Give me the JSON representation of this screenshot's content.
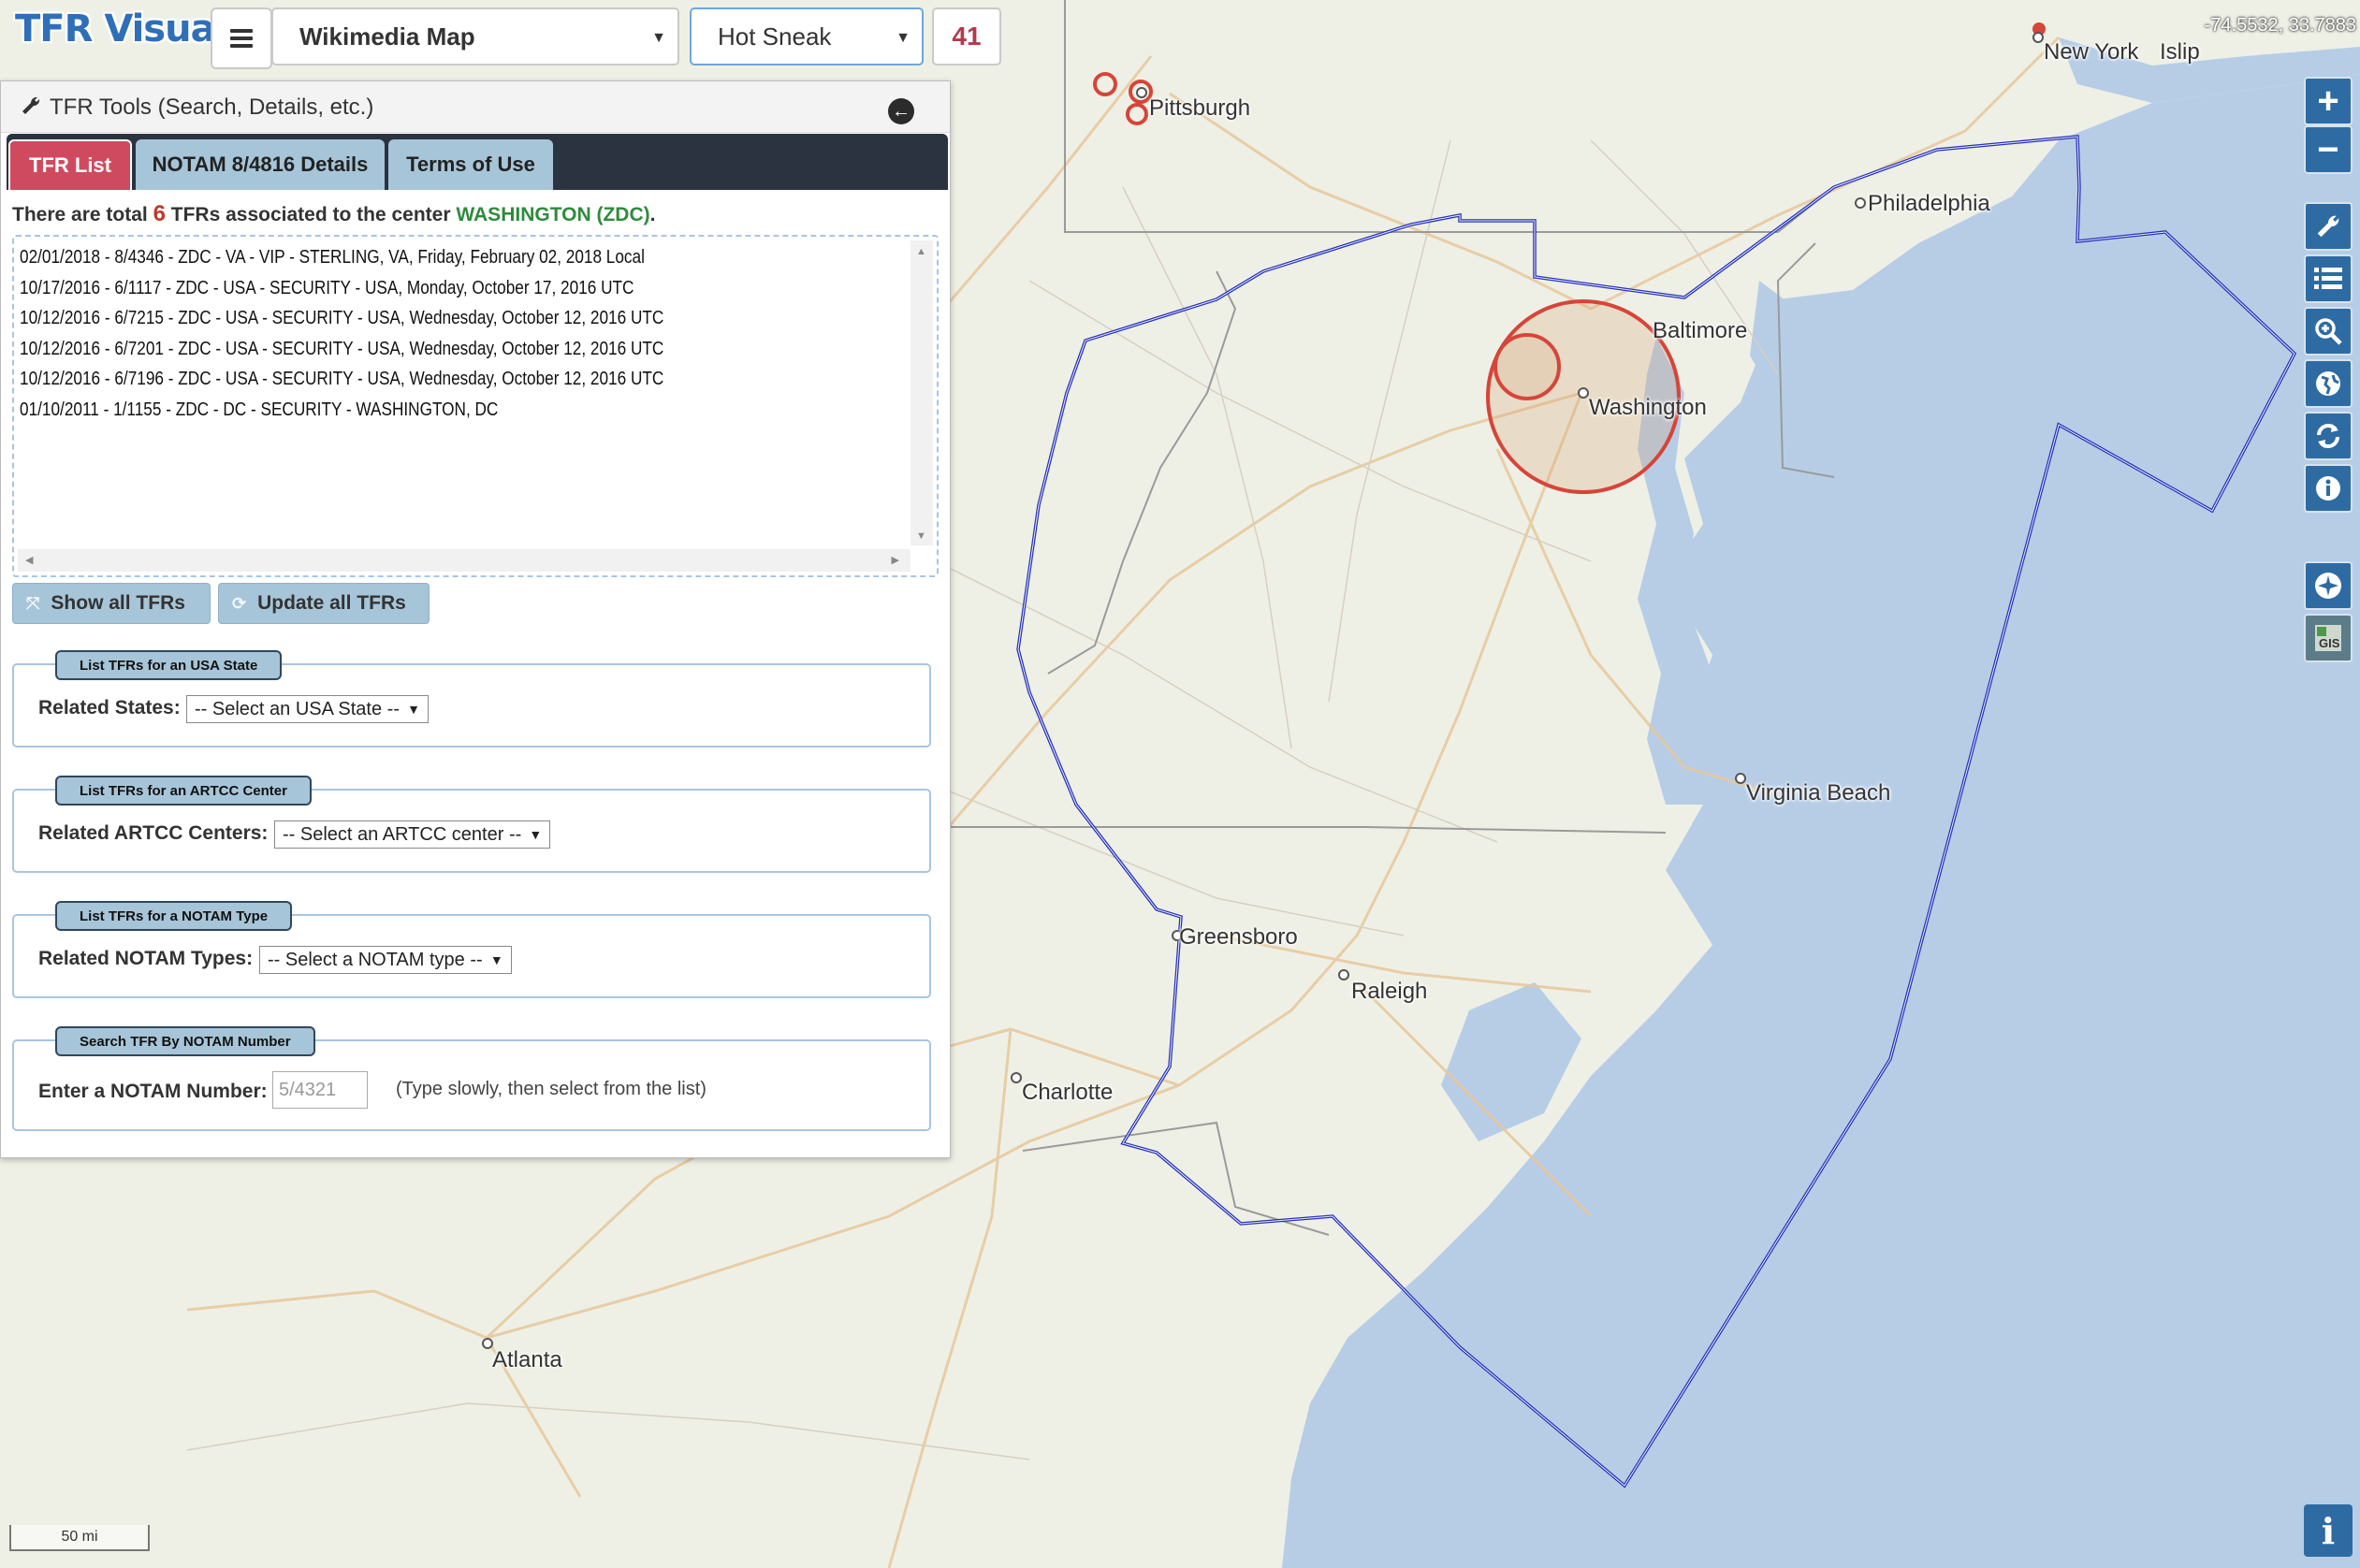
{
  "app": {
    "title": "TFR Visualizer"
  },
  "toolbar": {
    "map_layer": "Wikimedia Map",
    "map_style": "Hot Sneak",
    "tfr_count": "41",
    "coordinates": "-74.5532, 33.7883"
  },
  "panel": {
    "title": "TFR Tools (Search, Details, etc.)",
    "tabs": [
      "TFR List",
      "NOTAM 8/4816 Details",
      "Terms of Use"
    ],
    "summary": {
      "prefix": "There are total",
      "count": "6",
      "middle": "TFRs associated to the center",
      "center": "WASHINGTON (ZDC)",
      "suffix": "."
    },
    "tfr_items": [
      "02/01/2018 - 8/4346 - ZDC - VA - VIP - STERLING, VA, Friday, February 02, 2018 Local",
      "10/17/2016 - 6/1117 - ZDC - USA - SECURITY - USA, Monday, October 17, 2016 UTC",
      "10/12/2016 - 6/7215 - ZDC - USA - SECURITY - USA, Wednesday, October 12, 2016 UTC",
      "10/12/2016 - 6/7201 - ZDC - USA - SECURITY - USA, Wednesday, October 12, 2016 UTC",
      "10/12/2016 - 6/7196 - ZDC - USA - SECURITY - USA, Wednesday, October 12, 2016 UTC",
      "01/10/2011 - 1/1155 - ZDC - DC - SECURITY - WASHINGTON, DC"
    ],
    "buttons": {
      "show_all": "Show all TFRs",
      "update_all": "Update all TFRs"
    },
    "state_filter": {
      "legend": "List TFRs for an USA State",
      "label": "Related States:",
      "selected": "-- Select an USA State --"
    },
    "artcc_filter": {
      "legend": "List TFRs for an ARTCC Center",
      "label": "Related ARTCC Centers:",
      "selected": "-- Select an ARTCC center --"
    },
    "type_filter": {
      "legend": "List TFRs for a NOTAM Type",
      "label": "Related NOTAM Types:",
      "selected": "-- Select a NOTAM type --"
    },
    "notam_search": {
      "legend": "Search TFR By NOTAM Number",
      "label": "Enter a NOTAM Number:",
      "placeholder": "5/4321",
      "hint": "(Type slowly, then select from the list)"
    }
  },
  "map": {
    "cities": [
      "New York",
      "Islip",
      "Pittsburgh",
      "Philadelphia",
      "Baltimore",
      "Washington",
      "Virginia Beach",
      "Greensboro",
      "Raleigh",
      "Charlotte",
      "Atlanta"
    ],
    "scale_label": "50 mi",
    "colors": {
      "land": "#eef0e6",
      "water": "#b7cde6",
      "boundary": "#2733b8",
      "tfr_circle": "#d6453a"
    }
  },
  "controls": {
    "zoom_in": "+",
    "zoom_out": "−",
    "icons": [
      "wrench-icon",
      "list-icon",
      "zoom-search-icon",
      "globe-icon",
      "refresh-icon",
      "info-icon",
      "airport-icon",
      "gis-icon"
    ]
  }
}
